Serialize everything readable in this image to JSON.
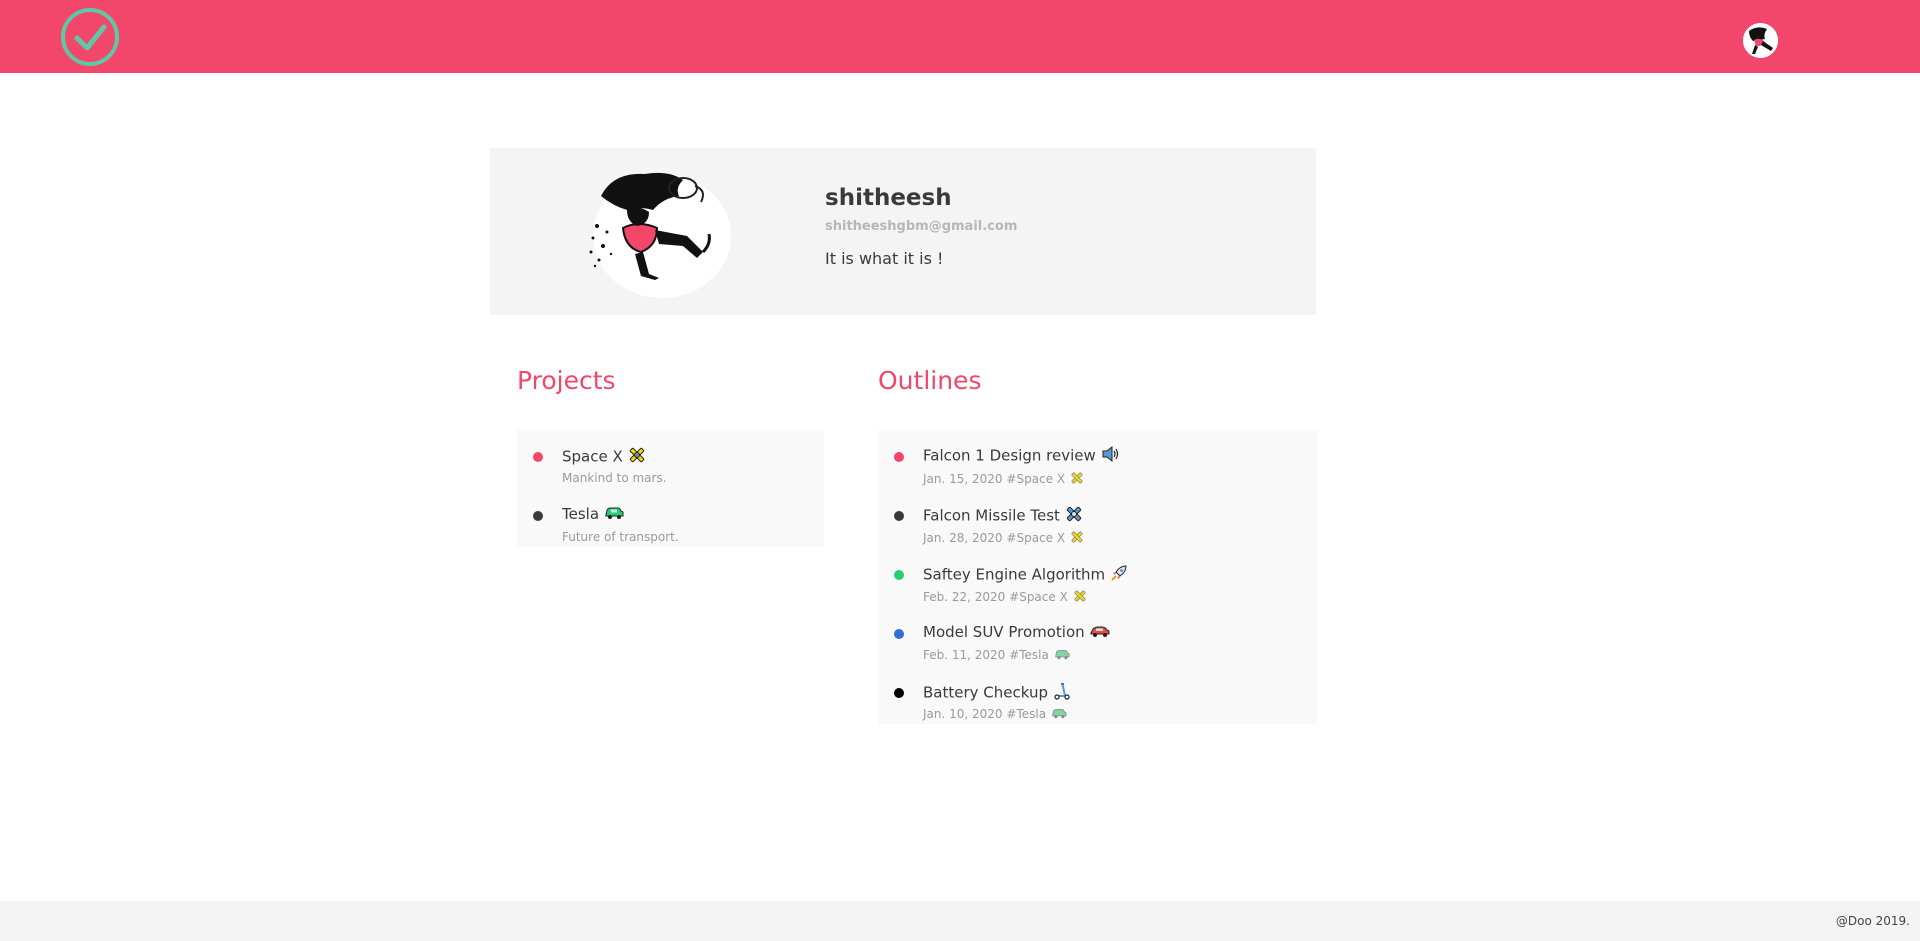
{
  "header": {
    "logo_icon": "check-circle-icon",
    "avatar_icon": "user-avatar-icon",
    "brand_color": "#f2476a",
    "logo_color": "#5fc7a3"
  },
  "profile": {
    "name": "shitheesh",
    "email": "shitheeshgbm@gmail.com",
    "bio": "It is what it is !",
    "image_icon": "profile-illustration-icon"
  },
  "projects": {
    "title": "Projects",
    "items": [
      {
        "name": "Space X",
        "description": "Mankind to mars.",
        "dot_color": "#f2476a",
        "emoji_icon": "satellite-icon"
      },
      {
        "name": "Tesla",
        "description": "Future of transport.",
        "dot_color": "#3a3a3a",
        "emoji_icon": "green-car-icon"
      }
    ]
  },
  "outlines": {
    "title": "Outlines",
    "items": [
      {
        "name": "Falcon 1 Design review",
        "date": "Jan. 15, 2020",
        "tag": "#Space X",
        "dot_color": "#f2476a",
        "emoji_icon": "speaker-icon",
        "tag_icon": "satellite-icon"
      },
      {
        "name": "Falcon Missile Test",
        "date": "Jan. 28, 2020",
        "tag": "#Space X",
        "dot_color": "#3a3a3a",
        "emoji_icon": "blue-satellite-icon",
        "tag_icon": "satellite-icon"
      },
      {
        "name": "Saftey Engine Algorithm",
        "date": "Feb. 22, 2020",
        "tag": "#Space X",
        "dot_color": "#2ecc71",
        "emoji_icon": "rocket-icon",
        "tag_icon": "satellite-icon"
      },
      {
        "name": "Model SUV Promotion",
        "date": "Feb. 11, 2020",
        "tag": "#Tesla",
        "dot_color": "#2f6fd6",
        "emoji_icon": "red-car-icon",
        "tag_icon": "green-car-icon"
      },
      {
        "name": "Battery Checkup",
        "date": "Jan. 10, 2020",
        "tag": "#Tesla",
        "dot_color": "#000000",
        "emoji_icon": "scooter-icon",
        "tag_icon": "green-car-icon"
      }
    ]
  },
  "footer": {
    "text": "@Doo 2019."
  }
}
